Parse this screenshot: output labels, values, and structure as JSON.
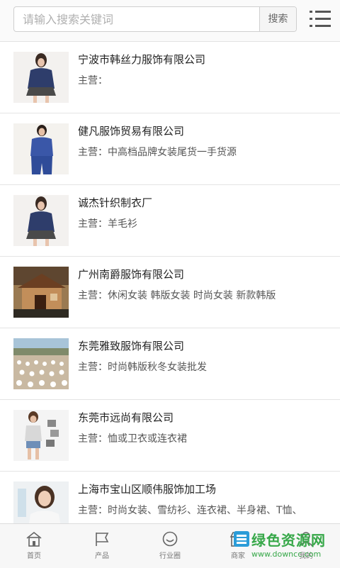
{
  "search": {
    "placeholder": "请输入搜索关键词",
    "button": "搜索"
  },
  "menu_icon": "list-menu-icon",
  "companies": [
    {
      "name": "宁波市韩丝力服饰有限公司",
      "main": "主营：",
      "thumb": "woman-blue-top-photo"
    },
    {
      "name": "健凡服饰贸易有限公司",
      "main": "主营：中高档品牌女装尾货一手货源",
      "thumb": "woman-blue-jumpsuit-photo"
    },
    {
      "name": "诚杰针织制衣厂",
      "main": "主营：羊毛衫",
      "thumb": "woman-blue-top-photo"
    },
    {
      "name": "广州南爵服饰有限公司",
      "main": "主营：休闲女装 韩版女装 时尚女装 新款韩版",
      "thumb": "building-photo"
    },
    {
      "name": "东莞雅致服饰有限公司",
      "main": "主营：时尚韩版秋冬女装批发",
      "thumb": "crowd-exercise-photo"
    },
    {
      "name": "东莞市远尚有限公司",
      "main": "主营：恤或卫衣或连衣裙",
      "thumb": "model-shorts-photo"
    },
    {
      "name": "上海市宝山区顺伟服饰加工场",
      "main": "主营：时尚女装、雪纺衫、连衣裙、半身裙、T恤、",
      "thumb": "woman-portrait-photo"
    }
  ],
  "nav": [
    {
      "label": "首页",
      "icon": "home-icon"
    },
    {
      "label": "产品",
      "icon": "flag-icon"
    },
    {
      "label": "行业圈",
      "icon": "circle-smile-icon"
    },
    {
      "label": "商家",
      "icon": "shop-icon"
    },
    {
      "label": "我的",
      "icon": "user-icon"
    }
  ],
  "watermark": {
    "name": "绿色资源网",
    "url": "www.downcc.com"
  }
}
